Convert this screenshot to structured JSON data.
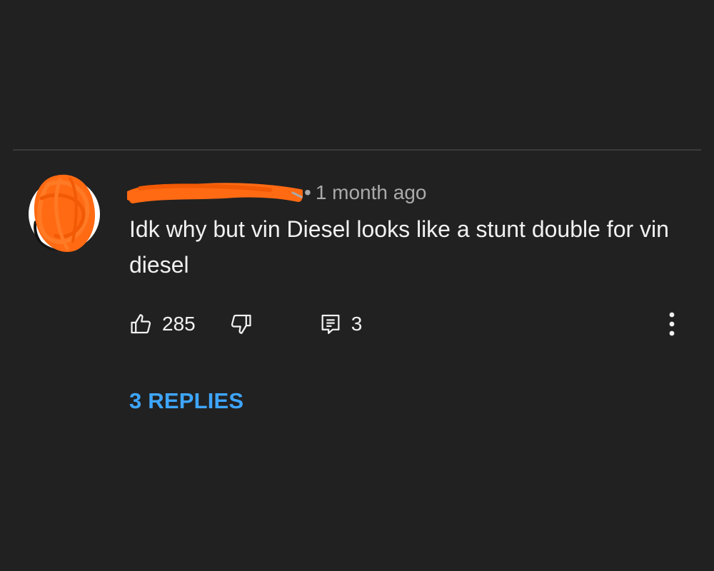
{
  "comment": {
    "author_redacted_color": "#ff6a13",
    "separator": "•",
    "timestamp": "1 month ago",
    "text": "Idk why but vin Diesel looks like a stunt double for vin diesel",
    "avatar_redacted_color": "#ff6a13"
  },
  "actions": {
    "like_icon": "thumbs-up-icon",
    "like_count": "285",
    "dislike_icon": "thumbs-down-icon",
    "reply_icon": "comment-icon",
    "reply_count": "3",
    "menu_icon": "more-vert-icon"
  },
  "replies": {
    "label": "3 REPLIES",
    "color": "#3ea6ff"
  },
  "colors": {
    "background": "#212121",
    "divider": "#3a3a3a",
    "text": "#f1f1f1",
    "secondary_text": "#aaaaaa"
  }
}
